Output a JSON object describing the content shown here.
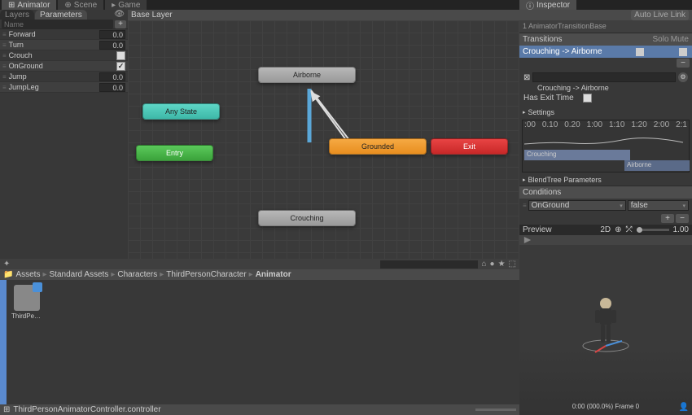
{
  "tabs": {
    "animator": "Animator",
    "scene": "Scene",
    "game": "Game",
    "inspector": "Inspector"
  },
  "subtabs": {
    "layers": "Layers",
    "parameters": "Parameters"
  },
  "search_placeholder": "Name",
  "params": [
    {
      "name": "Forward",
      "val": "0.0",
      "type": "float"
    },
    {
      "name": "Turn",
      "val": "0.0",
      "type": "float"
    },
    {
      "name": "Crouch",
      "type": "bool",
      "checked": false
    },
    {
      "name": "OnGround",
      "type": "bool",
      "checked": true
    },
    {
      "name": "Jump",
      "val": "0.0",
      "type": "float"
    },
    {
      "name": "JumpLeg",
      "val": "0.0",
      "type": "float"
    }
  ],
  "canvas": {
    "layer": "Base Layer",
    "live": "Auto Live Link",
    "path": "Standard Assets/Characters/ThirdPersonCharacter/Animator/ThirdPersonAnimatorController.controller",
    "nodes": {
      "airborne": "Airborne",
      "anystate": "Any State",
      "entry": "Entry",
      "grounded": "Grounded",
      "exit": "Exit",
      "crouching": "Crouching"
    }
  },
  "inspector_data": {
    "title": "Crouching -> Airborne",
    "sub": "1 AnimatorTransitionBase",
    "transitions_hdr": "Transitions",
    "solo": "Solo",
    "mute": "Mute",
    "trans": "Crouching -> Airborne",
    "name_field": "Crouching -> Airborne",
    "exit": "Has Exit Time",
    "settings": "Settings",
    "ticks": [
      ":00",
      "0.10",
      "0.20",
      "1:00",
      "1:10",
      "1:20",
      "2:00",
      "2:1"
    ],
    "bar1": "Crouching",
    "bar2": "Airborne",
    "blendtree": "BlendTree Parameters",
    "conditions": "Conditions",
    "cond_param": "OnGround",
    "cond_val": "false",
    "preview": "Preview",
    "2d": "2D",
    "speed": "1.00",
    "status": "0:00 (000.0%) Frame 0"
  },
  "project": {
    "breadcrumb": [
      "Assets",
      "Standard Assets",
      "Characters",
      "ThirdPersonCharacter",
      "Animator"
    ],
    "asset": "ThirdPerson...",
    "status": "ThirdPersonAnimatorController.controller"
  }
}
